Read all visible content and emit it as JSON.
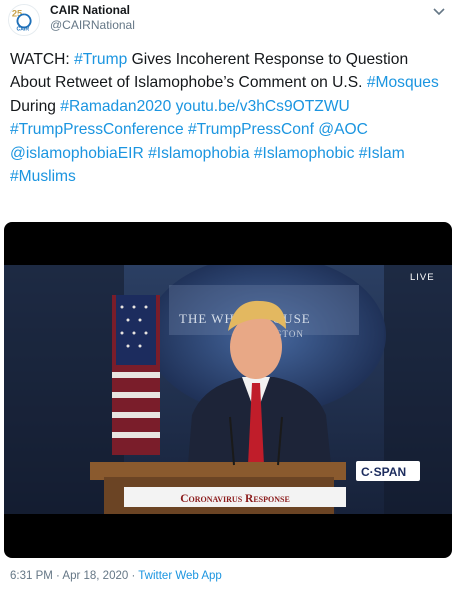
{
  "header": {
    "display_name": "CAIR National",
    "handle": "@CAIRNational",
    "avatar_logo_text": "CAIR",
    "avatar_number": "25"
  },
  "tweet": {
    "segments": [
      {
        "text": "WATCH: ",
        "link": false
      },
      {
        "text": "#Trump",
        "link": true
      },
      {
        "text": " Gives Incoherent Response to Question About Retweet of Islamophobe’s Comment on U.S. ",
        "link": false
      },
      {
        "text": "#Mosques",
        "link": true
      },
      {
        "text": " During ",
        "link": false
      },
      {
        "text": "#Ramadan2020",
        "link": true
      },
      {
        "text": " ",
        "link": false
      },
      {
        "text": "youtu.be/v3hCs9OTZWU",
        "link": true
      },
      {
        "text": " ",
        "link": false
      },
      {
        "text": "#TrumpPressConference",
        "link": true
      },
      {
        "text": " ",
        "link": false
      },
      {
        "text": "#TrumpPressConf",
        "link": true
      },
      {
        "text": " ",
        "link": false
      },
      {
        "text": "@AOC",
        "link": true
      },
      {
        "text": " ",
        "link": false
      },
      {
        "text": "@islamophobiaEIR",
        "link": true
      },
      {
        "text": " ",
        "link": false
      },
      {
        "text": "#Islamophobia",
        "link": true
      },
      {
        "text": " ",
        "link": false
      },
      {
        "text": "#Islamophobic",
        "link": true
      },
      {
        "text": " ",
        "link": false
      },
      {
        "text": "#Islam",
        "link": true
      },
      {
        "text": " ",
        "link": false
      },
      {
        "text": "#Muslims",
        "link": true
      }
    ]
  },
  "video": {
    "live_label": "LIVE",
    "network_logo": "C·SPAN",
    "banner": "Coronavirus Response",
    "backdrop_line1": "THE WHITE HOUSE",
    "backdrop_line2": "WASHINGTON"
  },
  "footer": {
    "timestamp": "6:31 PM · Apr 18, 2020 · ",
    "app": "Twitter Web App"
  },
  "colors": {
    "link": "#1b95e0",
    "secondary_text": "#657786",
    "banner_text": "#8b1a1a"
  }
}
